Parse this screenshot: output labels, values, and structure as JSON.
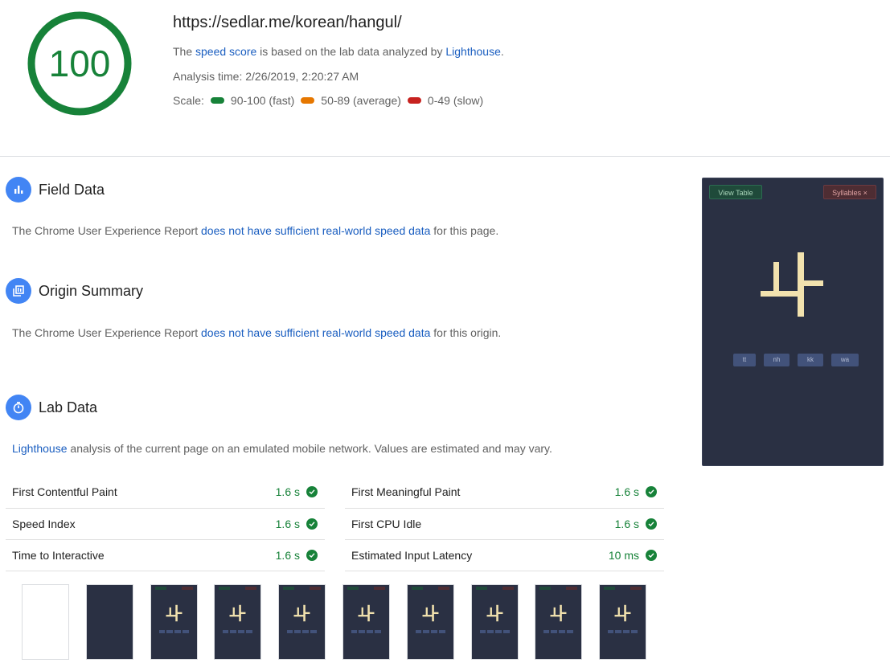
{
  "score": {
    "value": "100",
    "color": "#178239"
  },
  "header": {
    "url": "https://sedlar.me/korean/hangul/",
    "desc_prefix": "The ",
    "speed_score_link": "speed score",
    "desc_mid": " is based on the lab data analyzed by ",
    "lighthouse_link": "Lighthouse",
    "desc_suffix": ".",
    "analysis_time": "Analysis time: 2/26/2019, 2:20:27 AM",
    "scale_label": "Scale:",
    "scale": [
      {
        "label": "90-100 (fast)",
        "color": "#178239"
      },
      {
        "label": "50-89 (average)",
        "color": "#e67700"
      },
      {
        "label": "0-49 (slow)",
        "color": "#c7221f"
      }
    ]
  },
  "field_data": {
    "title": "Field Data",
    "icon": "bar-chart-icon",
    "text_prefix": "The Chrome User Experience Report ",
    "link": "does not have sufficient real-world speed data",
    "text_suffix": " for this page."
  },
  "origin_summary": {
    "title": "Origin Summary",
    "icon": "library-icon",
    "text_prefix": "The Chrome User Experience Report ",
    "link": "does not have sufficient real-world speed data",
    "text_suffix": " for this origin."
  },
  "lab_data": {
    "title": "Lab Data",
    "icon": "stopwatch-icon",
    "link": "Lighthouse",
    "text_suffix": " analysis of the current page on an emulated mobile network. Values are estimated and may vary."
  },
  "metrics": {
    "left": [
      {
        "name": "First Contentful Paint",
        "value": "1.6 s"
      },
      {
        "name": "Speed Index",
        "value": "1.6 s"
      },
      {
        "name": "Time to Interactive",
        "value": "1.6 s"
      }
    ],
    "right": [
      {
        "name": "First Meaningful Paint",
        "value": "1.6 s"
      },
      {
        "name": "First CPU Idle",
        "value": "1.6 s"
      },
      {
        "name": "Estimated Input Latency",
        "value": "10 ms"
      }
    ]
  },
  "screenshot": {
    "view_table": "View Table",
    "syllables": "Syllables ×",
    "glyph": "놔",
    "keys": [
      "tt",
      "nh",
      "kk",
      "wa"
    ],
    "bg_color": "#2a3043",
    "glyph_color": "#f2e2ae"
  },
  "filmstrip": {
    "frame_count": 10,
    "glyph": "놔"
  }
}
